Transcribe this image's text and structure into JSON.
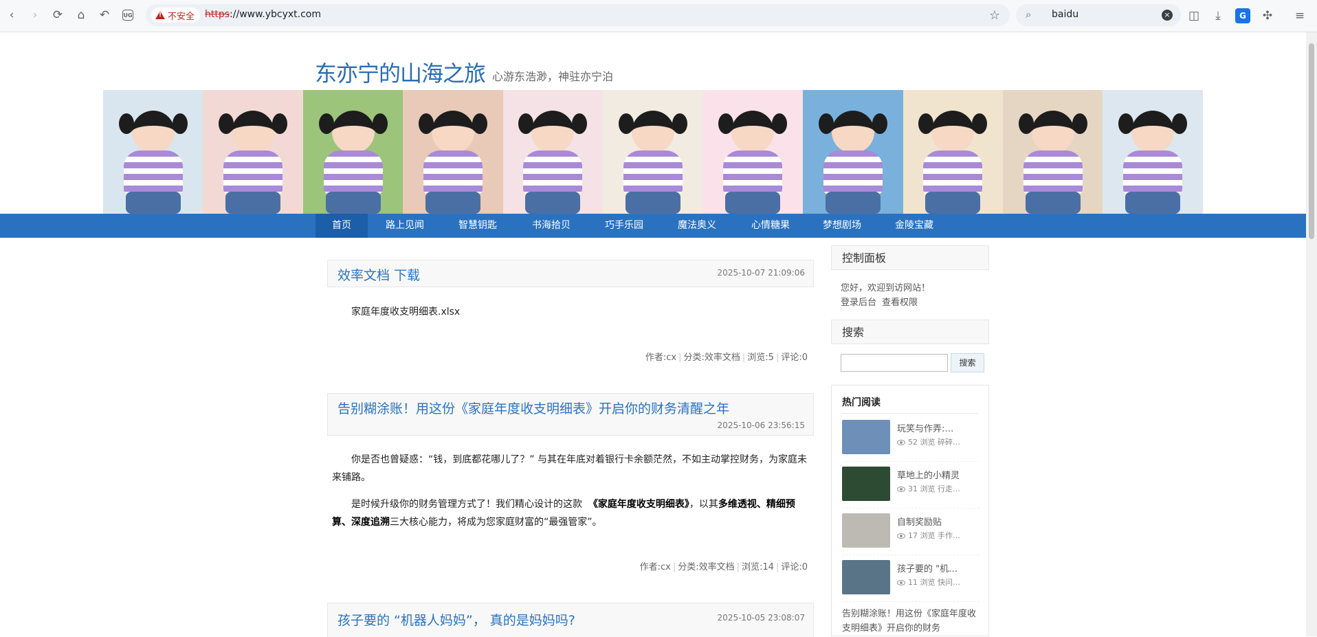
{
  "browser": {
    "insecure_label": "不安全",
    "url_scheme": "https",
    "url_rest": "://www.ybcyxt.com",
    "search_query": "baidu",
    "ug_label": "UG"
  },
  "site": {
    "title": "东亦宁的山海之旅",
    "tagline": "心游东浩渺，神驻亦宁泊"
  },
  "banner_tiles": [
    {
      "bg": "#d9e6ef"
    },
    {
      "bg": "#f3d9d5"
    },
    {
      "bg": "#9cc47a"
    },
    {
      "bg": "#e9c9b8"
    },
    {
      "bg": "#f4e2e6"
    },
    {
      "bg": "#f2ebe1"
    },
    {
      "bg": "#fbe1ea"
    },
    {
      "bg": "#7ab0dc"
    },
    {
      "bg": "#f0e4cf"
    },
    {
      "bg": "#e5d6c4"
    },
    {
      "bg": "#dde7ef"
    }
  ],
  "nav": [
    "首页",
    "路上见闻",
    "智慧钥匙",
    "书海拾贝",
    "巧手乐园",
    "魔法奥义",
    "心情糖果",
    "梦想剧场",
    "金陵宝藏"
  ],
  "posts": [
    {
      "title": "效率文档 下载",
      "date": "2025-10-07 21:09:06",
      "body": "家庭年度收支明细表.xlsx",
      "author": "作者:cx",
      "category": "分类:效率文档",
      "views": "浏览:5",
      "comments": "评论:0"
    },
    {
      "title": "告别糊涂账！用这份《家庭年度收支明细表》开启你的财务清醒之年",
      "date": "2025-10-06 23:56:15",
      "p1": "你是否也曾疑惑：“钱，到底都花哪儿了？” 与其在年底对着银行卡余额茫然，不如主动掌控财务，为家庭未来铺路。",
      "p2_a": "是时候升级你的财务管理方式了！我们精心设计的这款",
      "p2_b": "《家庭年度收支明细表》",
      "p2_c": "，以其",
      "p2_d": "多维透视、精细预算、深度追溯",
      "p2_e": "三大核心能力，将成为您家庭财富的“最强管家”。",
      "author": "作者:cx",
      "category": "分类:效率文档",
      "views": "浏览:14",
      "comments": "评论:0"
    },
    {
      "title": "孩子要的 “机器人妈妈”， 真的是妈妈吗?",
      "date": "2025-10-05 23:08:07"
    }
  ],
  "sidebar": {
    "control_title": "控制面板",
    "welcome": "您好，欢迎到访网站！",
    "login_link": "登录后台",
    "perm_link": "查看权限",
    "search_title": "搜索",
    "search_button": "搜索",
    "hot_title": "热门阅读",
    "hot": [
      {
        "name": "玩笑与作弄:…",
        "views": "52 浏览 碎碎…",
        "color": "#6d8fb8"
      },
      {
        "name": "草地上的小精灵",
        "views": "31 浏览 行走…",
        "color": "#2d4a32"
      },
      {
        "name": "自制奖励贴",
        "views": "17 浏览 手作…",
        "color": "#bcbab3"
      },
      {
        "name": "孩子要的 \"机…",
        "views": "11 浏览 快问…",
        "color": "#5a7487"
      }
    ],
    "hot_tail": "告别糊涂账！用这份《家庭年度收支明细表》开启你的财务"
  }
}
